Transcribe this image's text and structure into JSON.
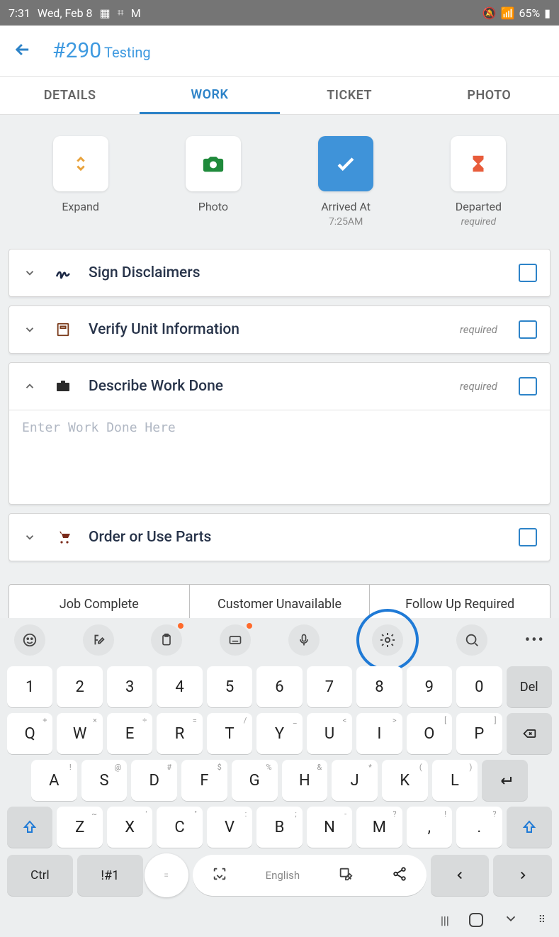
{
  "statusbar": {
    "time": "7:31",
    "date": "Wed, Feb 8",
    "battery": "65%"
  },
  "appbar": {
    "id": "#290",
    "name": "Testing"
  },
  "tabs": [
    "DETAILS",
    "WORK",
    "TICKET",
    "PHOTO"
  ],
  "active_tab": 1,
  "actions": [
    {
      "label": "Expand",
      "sub": ""
    },
    {
      "label": "Photo",
      "sub": ""
    },
    {
      "label": "Arrived At",
      "sub": "7:25AM"
    },
    {
      "label": "Departed",
      "sub": "required"
    }
  ],
  "items": [
    {
      "title": "Sign Disclaimers",
      "required": false,
      "expanded": false
    },
    {
      "title": "Verify Unit Information",
      "required": true,
      "expanded": false
    },
    {
      "title": "Describe Work Done",
      "required": true,
      "expanded": true,
      "placeholder": "Enter Work Done Here"
    },
    {
      "title": "Order or Use Parts",
      "required": false,
      "expanded": false
    }
  ],
  "required_label": "required",
  "footer": [
    "Job Complete",
    "Customer Unavailable",
    "Follow Up Required"
  ],
  "keyboard": {
    "row_num": [
      "1",
      "2",
      "3",
      "4",
      "5",
      "6",
      "7",
      "8",
      "9",
      "0",
      "Del"
    ],
    "row_q": [
      [
        "Q",
        "+"
      ],
      [
        "W",
        "×"
      ],
      [
        "E",
        "÷"
      ],
      [
        "R",
        "="
      ],
      [
        "T",
        "/"
      ],
      [
        "Y",
        "_"
      ],
      [
        "U",
        "<"
      ],
      [
        "I",
        ">"
      ],
      [
        "O",
        "["
      ],
      [
        "P",
        "]"
      ]
    ],
    "row_a": [
      [
        "A",
        "!"
      ],
      [
        "S",
        "@"
      ],
      [
        "D",
        "#"
      ],
      [
        "F",
        "$"
      ],
      [
        "G",
        "%"
      ],
      [
        "H",
        "&"
      ],
      [
        "J",
        "*"
      ],
      [
        "K",
        "("
      ],
      [
        "L",
        ")"
      ]
    ],
    "row_z": [
      [
        "Z",
        "~"
      ],
      [
        "X",
        "'"
      ],
      [
        "C",
        "\""
      ],
      [
        "V",
        ":"
      ],
      [
        "B",
        ";"
      ],
      [
        "N",
        "-"
      ],
      [
        "M",
        "?"
      ],
      [
        ",",
        "!"
      ],
      [
        ".",
        "?"
      ]
    ],
    "ctrl": "Ctrl",
    "sym": "!#1",
    "lang": "English"
  }
}
